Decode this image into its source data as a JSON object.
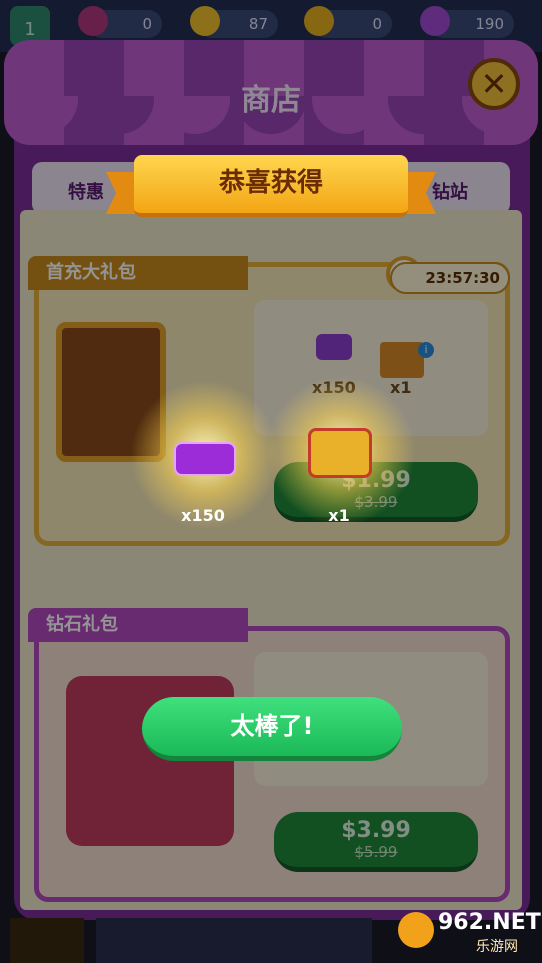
{
  "top_bar": {
    "level": "1",
    "resources": [
      {
        "icon": "gem-pack-icon",
        "value": "0"
      },
      {
        "icon": "lightning-icon",
        "value": "87"
      },
      {
        "icon": "coin-icon",
        "value": "0"
      },
      {
        "icon": "diamond-icon",
        "value": "190"
      }
    ]
  },
  "shop": {
    "title": "商店",
    "close_icon": "close-icon",
    "tabs": [
      {
        "label": "特惠"
      },
      {
        "label": "钻站"
      }
    ],
    "timer": "23:57:30",
    "packs": [
      {
        "name": "首充大礼包",
        "items": [
          {
            "icon": "amethyst-icon",
            "qty": "x150"
          },
          {
            "icon": "gift-box-icon",
            "qty": "x1"
          }
        ],
        "price": "$1.99",
        "old_price": "$3.99"
      },
      {
        "name": "钻石礼包",
        "price": "$3.99",
        "old_price": "$5.99"
      }
    ]
  },
  "reward_popup": {
    "banner": "恭喜获得",
    "rewards": [
      {
        "icon": "amethyst-icon",
        "qty": "x150"
      },
      {
        "icon": "gift-box-icon",
        "qty": "x1"
      }
    ],
    "confirm_label": "太棒了!"
  },
  "watermark": {
    "brand": "962.NET",
    "sub": "乐游网"
  },
  "colors": {
    "panel_purple": "#7f2e9a",
    "banner_gold": "#f3a514",
    "confirm_green": "#1bb957",
    "price_green": "#1f8a3a"
  }
}
